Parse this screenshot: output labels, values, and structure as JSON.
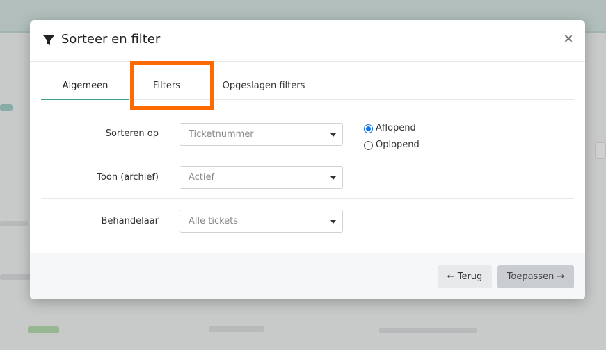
{
  "modal": {
    "title": "Sorteer en filter",
    "close_label": "×"
  },
  "tabs": [
    {
      "label": "Algemeen",
      "active": true
    },
    {
      "label": "Filters",
      "active": false
    },
    {
      "label": "Opgeslagen filters",
      "active": false
    }
  ],
  "form": {
    "sort": {
      "label": "Sorteren op",
      "value": "Ticketnummer"
    },
    "order": [
      {
        "label": "Aflopend",
        "checked": true
      },
      {
        "label": "Oplopend",
        "checked": false
      }
    ],
    "archive": {
      "label": "Toon (archief)",
      "value": "Actief"
    },
    "handler": {
      "label": "Behandelaar",
      "value": "Alle tickets"
    }
  },
  "footer": {
    "back_label": "← Terug",
    "apply_label": "Toepassen →"
  },
  "colors": {
    "accent": "#3b9d8f",
    "highlight": "#ff6a00",
    "radio": "#1a73e8"
  }
}
